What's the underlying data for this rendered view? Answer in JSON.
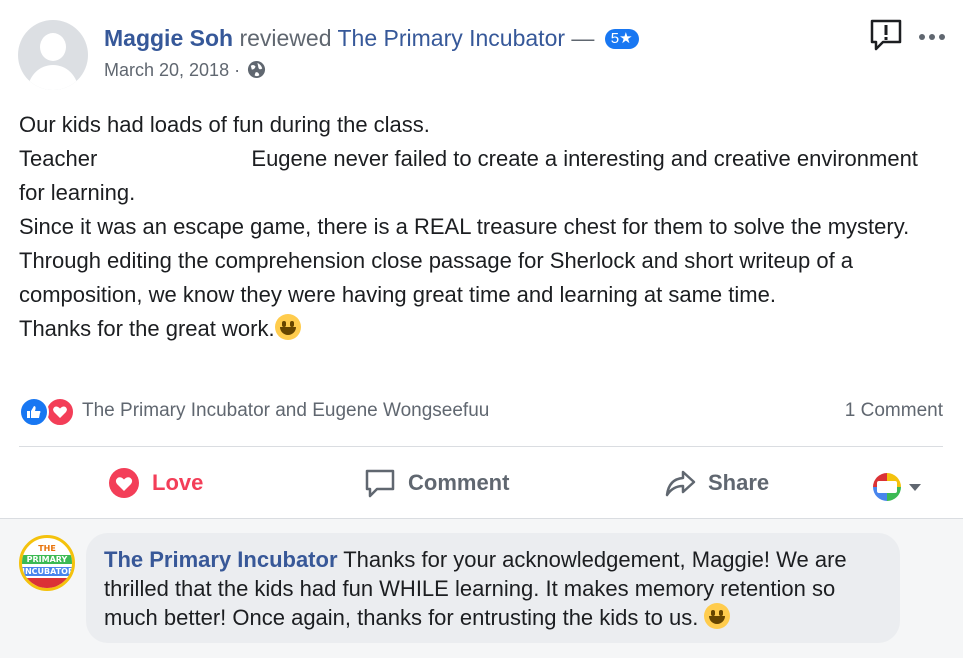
{
  "post": {
    "author": "Maggie Soh",
    "action": " reviewed ",
    "page_name": "The Primary Incubator",
    "dash": " — ",
    "rating": "5",
    "rating_star": "★",
    "date": "March 20, 2018",
    "date_sep": " · ",
    "privacy_icon": "globe-icon",
    "body": {
      "line1": "Our kids had loads of fun during the class.",
      "line2a": "Teacher",
      "line2b": " Eugene never failed to create a interesting and creative environment for learning.",
      "line3": "Since it was an escape game, there is a REAL treasure chest for them to solve the mystery.",
      "line4": "Through editing the comprehension close passage for Sherlock and short writeup of a composition, we know they were having great time and learning at same time.",
      "line5": "Thanks for the great work."
    }
  },
  "reactions": {
    "icons": [
      "like-icon",
      "heart-icon"
    ],
    "reactors": "The Primary Incubator and Eugene Wongseefuu",
    "comment_count": "1 Comment"
  },
  "actions": {
    "love": "Love",
    "comment": "Comment",
    "share": "Share"
  },
  "comment": {
    "author": "The Primary Incubator",
    "text": " Thanks for your acknowledgement, Maggie! We are thrilled that the kids had fun WHILE learning. It makes memory retention so much better! Once again, thanks for entrusting the kids to us. ",
    "avatar_text": [
      "THE",
      "PRIMARY",
      "INCUBATOR"
    ]
  },
  "colors": {
    "link": "#365899",
    "love": "#f33e58",
    "like": "#1877f2",
    "muted": "#606770"
  }
}
